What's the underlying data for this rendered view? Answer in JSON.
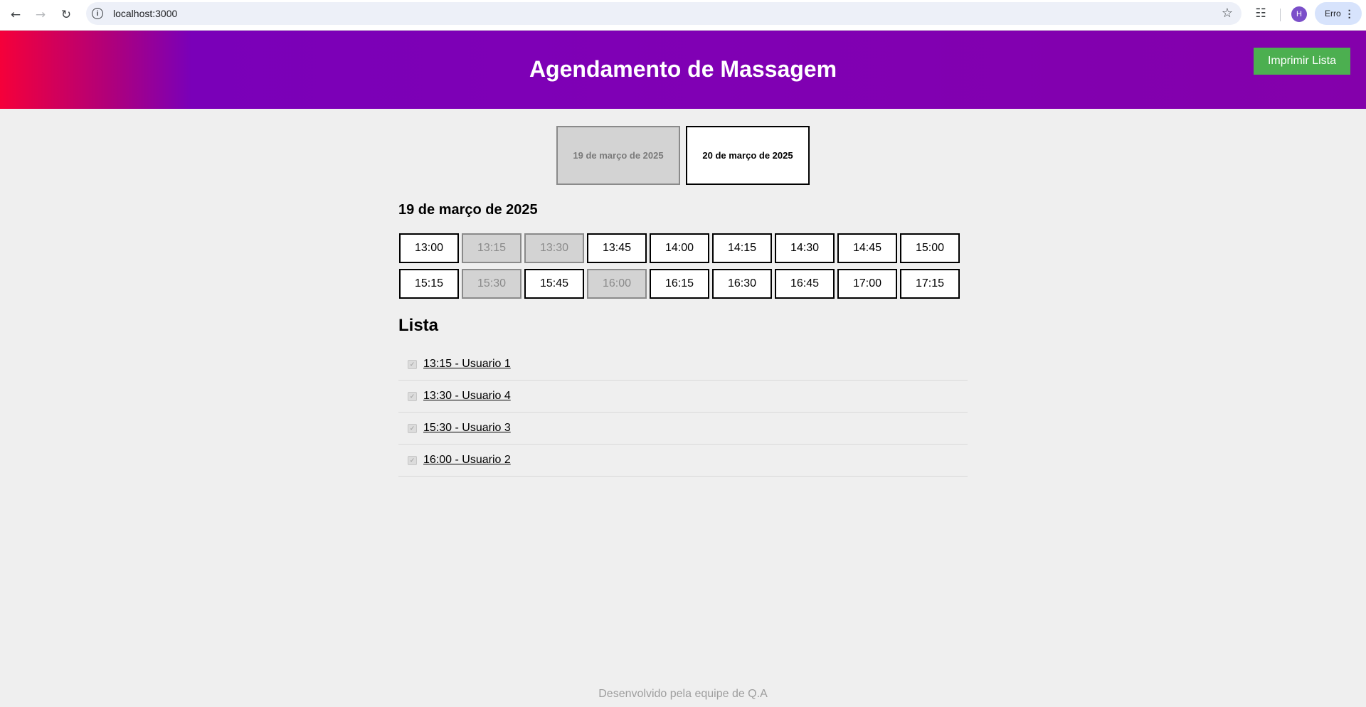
{
  "browser": {
    "url": "localhost:3000",
    "profile_initial": "H",
    "profile_label": "Erro",
    "icons": [
      "back-arrow-icon",
      "forward-arrow-icon",
      "reload-icon",
      "site-info-icon",
      "bookmark-star-icon",
      "extensions-icon",
      "kebab-menu-icon"
    ]
  },
  "header": {
    "title": "Agendamento de Massagem",
    "print_label": "Imprimir Lista",
    "colors": {
      "gradient_start": "#f5003a",
      "gradient_mid": "#7a00b8",
      "gradient_end": "#8400ab",
      "print_button": "#4caf50"
    }
  },
  "date_tabs": [
    {
      "label": "19 de março de 2025",
      "active": true
    },
    {
      "label": "20 de março de 2025",
      "active": false
    }
  ],
  "selected_date": "19 de março de 2025",
  "slots": [
    {
      "time": "13:00",
      "booked": false
    },
    {
      "time": "13:15",
      "booked": true
    },
    {
      "time": "13:30",
      "booked": true
    },
    {
      "time": "13:45",
      "booked": false
    },
    {
      "time": "14:00",
      "booked": false
    },
    {
      "time": "14:15",
      "booked": false
    },
    {
      "time": "14:30",
      "booked": false
    },
    {
      "time": "14:45",
      "booked": false
    },
    {
      "time": "15:00",
      "booked": false
    },
    {
      "time": "15:15",
      "booked": false
    },
    {
      "time": "15:30",
      "booked": true
    },
    {
      "time": "15:45",
      "booked": false
    },
    {
      "time": "16:00",
      "booked": true
    },
    {
      "time": "16:15",
      "booked": false
    },
    {
      "time": "16:30",
      "booked": false
    },
    {
      "time": "16:45",
      "booked": false
    },
    {
      "time": "17:00",
      "booked": false
    },
    {
      "time": "17:15",
      "booked": false
    }
  ],
  "list": {
    "title": "Lista",
    "items": [
      {
        "text": "13:15 - Usuario 1",
        "checked": true
      },
      {
        "text": "13:30 - Usuario 4",
        "checked": true
      },
      {
        "text": "15:30 - Usuario 3",
        "checked": true
      },
      {
        "text": "16:00 - Usuario 2",
        "checked": true
      }
    ]
  },
  "footer": {
    "text": "Desenvolvido pela equipe de Q.A"
  }
}
